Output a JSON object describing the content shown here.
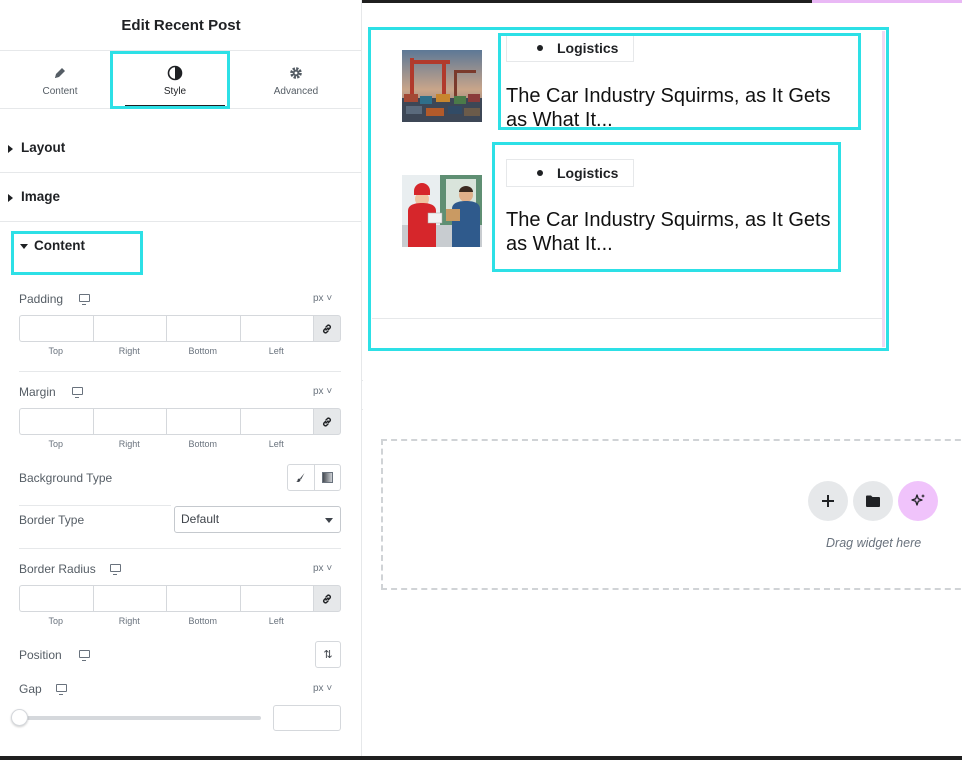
{
  "panel": {
    "title": "Edit Recent Post",
    "tabs": [
      {
        "label": "Content",
        "icon": "pencil-icon"
      },
      {
        "label": "Style",
        "icon": "contrast-icon"
      },
      {
        "label": "Advanced",
        "icon": "gear-icon"
      }
    ],
    "active_tab": "Style",
    "sections": {
      "layout": "Layout",
      "image": "Image",
      "content": "Content"
    },
    "controls": {
      "padding": {
        "label": "Padding",
        "unit": "px",
        "sides": [
          "Top",
          "Right",
          "Bottom",
          "Left"
        ]
      },
      "margin": {
        "label": "Margin",
        "unit": "px",
        "sides": [
          "Top",
          "Right",
          "Bottom",
          "Left"
        ]
      },
      "background_type": {
        "label": "Background Type"
      },
      "border_type": {
        "label": "Border Type",
        "value": "Default"
      },
      "border_radius": {
        "label": "Border Radius",
        "unit": "px",
        "sides": [
          "Top",
          "Right",
          "Bottom",
          "Left"
        ]
      },
      "position": {
        "label": "Position"
      },
      "gap": {
        "label": "Gap",
        "unit": "px",
        "slider_value": 0
      }
    }
  },
  "canvas": {
    "posts": [
      {
        "category": "Logistics",
        "title": "The Car Industry Squirms, as It Gets as What It..."
      },
      {
        "category": "Logistics",
        "title": "The Car Industry Squirms, as It Gets as What It..."
      }
    ],
    "drop_text": "Drag widget here"
  },
  "colors": {
    "highlight": "#2de0e6",
    "ai_button": "#f0c3fb",
    "panel_text": "#1f2124"
  }
}
